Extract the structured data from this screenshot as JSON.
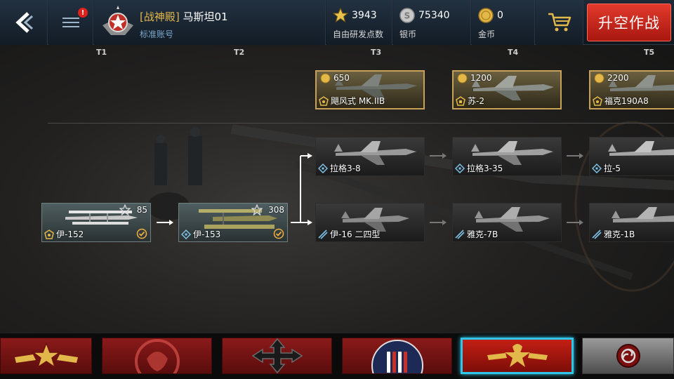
{
  "topbar": {
    "profile": {
      "title": "[战神殿]",
      "name": "马斯坦01",
      "account_type": "标准账号"
    },
    "research_points": {
      "value": "3943",
      "label": "自由研发点数",
      "icon": "star-icon"
    },
    "silver": {
      "value": "75340",
      "label": "银币",
      "icon": "silver-coin-icon"
    },
    "gold": {
      "value": "0",
      "label": "金币",
      "icon": "gold-coin-icon"
    },
    "battle_button": "升空作战",
    "menu_badge": "!"
  },
  "tiers": [
    "T1",
    "T2",
    "T3",
    "T4",
    "T5"
  ],
  "premium_planes": [
    {
      "name": "飓风式 MK.IIB",
      "price": "650"
    },
    {
      "name": "苏-2",
      "price": "1200"
    },
    {
      "name": "福克190A8",
      "price": "2200"
    }
  ],
  "tree_planes": {
    "tier1": {
      "name": "伊-152",
      "rp": "85",
      "owned": true
    },
    "tier2": {
      "name": "伊-153",
      "rp": "308",
      "owned": true
    },
    "upper": [
      {
        "name": "拉格3-8"
      },
      {
        "name": "拉格3-35"
      },
      {
        "name": "拉-5"
      }
    ],
    "lower": [
      {
        "name": "伊-16 二四型"
      },
      {
        "name": "雅克-7B"
      },
      {
        "name": "雅克-1B"
      }
    ]
  },
  "nations": [
    {
      "id": "china",
      "icon": "china-star-emblem-icon"
    },
    {
      "id": "uk",
      "icon": "lion-emblem-icon"
    },
    {
      "id": "germany",
      "icon": "iron-cross-icon"
    },
    {
      "id": "usa",
      "icon": "us-star-roundel-icon"
    },
    {
      "id": "ussr",
      "icon": "soviet-bear-star-icon",
      "selected": true
    },
    {
      "id": "japan",
      "icon": "tomoe-emblem-icon"
    }
  ],
  "colors": {
    "accent_red": "#c31f14",
    "selected_outline": "#2fc6e8",
    "premium_gold": "#c9a25a",
    "clan_tag": "#e2b84a"
  }
}
